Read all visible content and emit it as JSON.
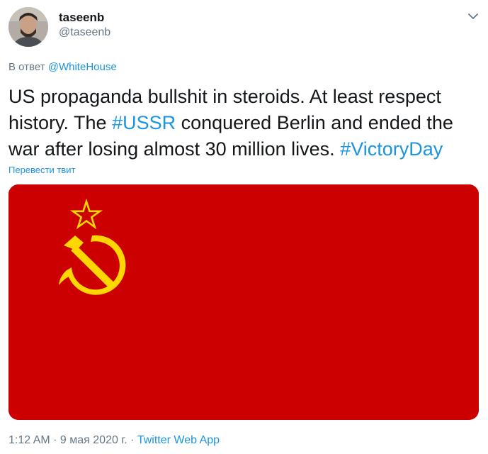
{
  "author": {
    "display_name": "taseenb",
    "handle": "@taseenb"
  },
  "reply": {
    "prefix": "В ответ",
    "mention": "@WhiteHouse"
  },
  "tweet": {
    "text_part1": "US propaganda bullshit in steroids. At least respect history. The ",
    "hashtag1": "#USSR",
    "text_part2": " conquered Berlin and ended the war after losing almost 30 million lives. ",
    "hashtag2": "#VictoryDay"
  },
  "translate_label": "Перевести твит",
  "meta": {
    "time": "1:12 AM",
    "separator1": " · ",
    "date": "9 мая 2020 г.",
    "separator2": " · ",
    "client": "Twitter Web App"
  },
  "icons": {
    "caret": "chevron-down-icon"
  },
  "colors": {
    "flag_red": "#cc0000",
    "emblem_gold": "#ffd700",
    "link_blue": "#1b95e0",
    "secondary_text": "#657786"
  }
}
